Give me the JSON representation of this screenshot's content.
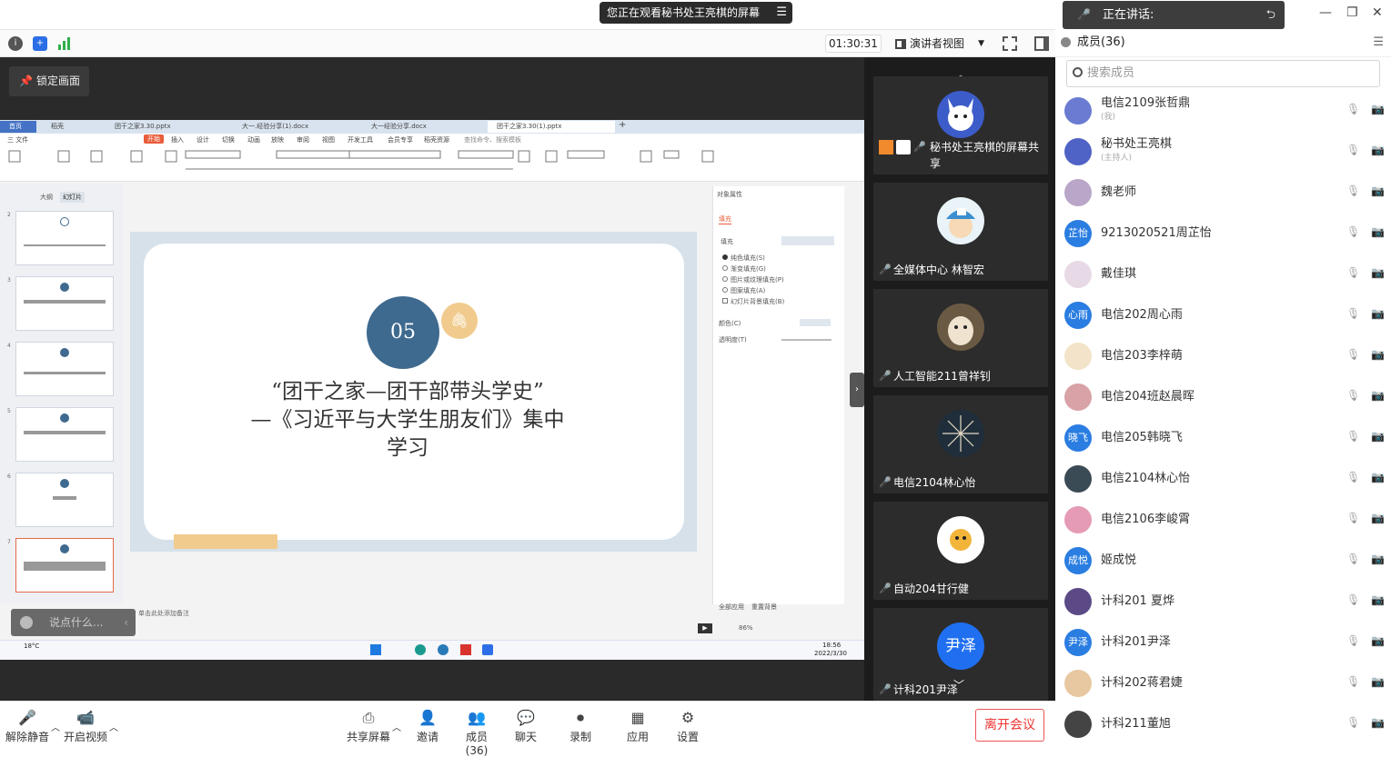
{
  "banner": {
    "sharing_text": "您正在观看秘书处王亮棋的屏幕",
    "menu_icon": "list-icon"
  },
  "toolbar": {
    "timer": "01:30:31",
    "view_mode": "演讲者视图"
  },
  "share": {
    "lock_label": "锁定画面",
    "chat_placeholder": "说点什么..."
  },
  "wps": {
    "tabs": [
      "首页",
      "稻壳",
      "团干之家3.30.pptx",
      "大一.经验分享(1).docx",
      "大一经验分享.docx",
      "团干之家3.30(1).pptx"
    ],
    "menu": [
      "三 文件",
      "开始",
      "插入",
      "设计",
      "切换",
      "动画",
      "放映",
      "审阅",
      "视图",
      "开发工具",
      "会员专享",
      "稻壳资源",
      "查找命令、搜索模板"
    ],
    "panel_tabs": [
      "大纲",
      "幻灯片"
    ],
    "slide_number": "05",
    "slide_title": "“团干之家—团干部带头学史”\n—《习近平与大学生朋友们》集中\n学习",
    "props": {
      "title": "对象属性",
      "tab": "填充",
      "fill_label": "填充",
      "options": [
        "纯色填充(S)",
        "渐变填充(G)",
        "图片或纹理填充(P)",
        "图案填充(A)",
        "幻灯片背景填充(B)"
      ],
      "color_label": "颜色(C)",
      "transparency_label": "透明度(T)",
      "footer": [
        "全部应用",
        "重置背景"
      ]
    },
    "notes": "单击此处添加备注",
    "status": {
      "zoom": "86%",
      "weather": "18°C",
      "time": "18:56",
      "date": "2022/3/30"
    }
  },
  "tiles": [
    {
      "name": "秘书处王亮棋的屏幕共享"
    },
    {
      "name": "全媒体中心 林智宏"
    },
    {
      "name": "人工智能211曾祥钊"
    },
    {
      "name": "电信2104林心怡"
    },
    {
      "name": "自动204甘行健"
    },
    {
      "name": "计科201尹泽",
      "avatar_text": "尹泽"
    }
  ],
  "right": {
    "speaking_label": "正在讲话:",
    "members_title": "成员(36)",
    "search_placeholder": "搜索成员",
    "members": [
      {
        "name": "电信2109张哲鼎",
        "sub": "(我)",
        "avatar": "",
        "color": "#6a7bd1"
      },
      {
        "name": "秘书处王亮棋",
        "sub": "(主持人)",
        "avatar": "",
        "color": "#4f62c5"
      },
      {
        "name": "魏老师",
        "sub": "",
        "avatar": "",
        "color": "#b9a6c9"
      },
      {
        "name": "9213020521周芷怡",
        "sub": "",
        "avatar": "芷怡",
        "color": "#2a7de1"
      },
      {
        "name": "戴佳琪",
        "sub": "",
        "avatar": "",
        "color": "#e8d9e6"
      },
      {
        "name": "电信202周心雨",
        "sub": "",
        "avatar": "心雨",
        "color": "#2a7de1"
      },
      {
        "name": "电信203李梓萌",
        "sub": "",
        "avatar": "",
        "color": "#f3e3c8"
      },
      {
        "name": "电信204班赵晨晖",
        "sub": "",
        "avatar": "",
        "color": "#d8a2a7"
      },
      {
        "name": "电信205韩晓飞",
        "sub": "",
        "avatar": "晓飞",
        "color": "#2a7de1"
      },
      {
        "name": "电信2104林心怡",
        "sub": "",
        "avatar": "",
        "color": "#3b4b55"
      },
      {
        "name": "电信2106李峻霄",
        "sub": "",
        "avatar": "",
        "color": "#e59bb5"
      },
      {
        "name": "姬成悦",
        "sub": "",
        "avatar": "成悦",
        "color": "#2a7de1"
      },
      {
        "name": "计科201 夏烨",
        "sub": "",
        "avatar": "",
        "color": "#5b4a86"
      },
      {
        "name": "计科201尹泽",
        "sub": "",
        "avatar": "尹泽",
        "color": "#2a7de1"
      },
      {
        "name": "计科202蒋君婕",
        "sub": "",
        "avatar": "",
        "color": "#e7c8a1"
      },
      {
        "name": "计科211董旭",
        "sub": "",
        "avatar": "",
        "color": "#444"
      }
    ]
  },
  "bottom": {
    "mute": "解除静音",
    "video": "开启视频",
    "share": "共享屏幕",
    "invite": "邀请",
    "members": "成员(36)",
    "chat": "聊天",
    "record": "录制",
    "apps": "应用",
    "settings": "设置",
    "leave": "离开会议"
  }
}
